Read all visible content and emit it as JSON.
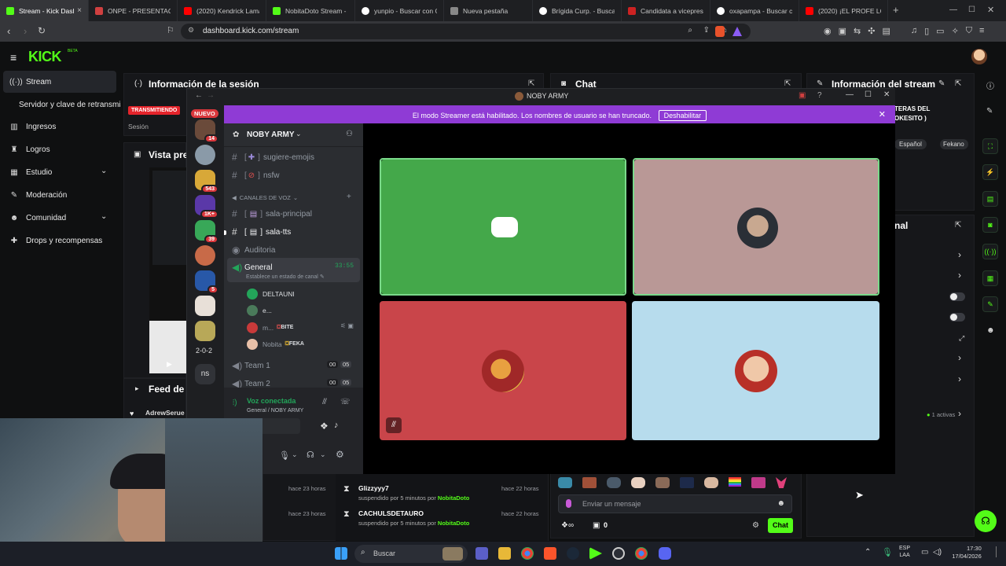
{
  "browser": {
    "tabs": [
      {
        "title": "Stream - Kick Dash",
        "color": "#53fc18",
        "active": true
      },
      {
        "title": "ONPE - PRESENTACIÓN",
        "color": "#d04040"
      },
      {
        "title": "(2020) Kendrick Lamar",
        "color": "#ff0000"
      },
      {
        "title": "NobitaDoto Stream - V",
        "color": "#53fc18"
      },
      {
        "title": "yunpio - Buscar con G",
        "color": "#ffffff"
      },
      {
        "title": "Nueva pestaña",
        "color": "#aaaaaa"
      },
      {
        "title": "Brígida Curp. - Buscar",
        "color": "#ffffff"
      },
      {
        "title": "Candidata a vicepresid",
        "color": "#cc2222"
      },
      {
        "title": "oxapampa - Buscar co",
        "color": "#ffffff"
      },
      {
        "title": "(2020) ¡EL PROFE LO A",
        "color": "#ff0000"
      }
    ],
    "url": "dashboard.kick.com/stream"
  },
  "kick": {
    "logo": "KICK",
    "logo_sup": "BETA",
    "sidebar": [
      {
        "label": "Stream",
        "icon": "stream-icon"
      },
      {
        "label": "Servidor y clave de retransmisión",
        "icon": ""
      },
      {
        "label": "Ingresos",
        "icon": "chart-icon"
      },
      {
        "label": "Logros",
        "icon": "trophy-icon"
      },
      {
        "label": "Estudio",
        "icon": "studio-icon"
      },
      {
        "label": "Moderación",
        "icon": "wrench-icon"
      },
      {
        "label": "Comunidad",
        "icon": "people-icon"
      },
      {
        "label": "Drops y recompensas",
        "icon": "gift-icon"
      }
    ],
    "session_title": "Información de la sesión",
    "session_live": "TRANSMITIENDO",
    "session_label": "Sesión",
    "preview_title": "Vista pre",
    "feed_title": "Feed de a",
    "feed_user": "AdrewSerue",
    "chat_title": "Chat",
    "stream_info_title": "Información del stream",
    "stream_info_text": "TERAS DEL\nOKESITO )",
    "stream_tags": [
      "Español",
      "Fekano"
    ],
    "channel_title": "nal",
    "actives": "1 activas",
    "mod_log": [
      {
        "user": "Glizzyyy7",
        "action": "suspendido por 5 minutos por",
        "mod": "NobitaDoto",
        "time": "hace 22 horas"
      },
      {
        "user": "CACHULSDETAURO",
        "action": "suspendido por 5 minutos por",
        "mod": "NobitaDoto",
        "time": "hace 22 horas"
      }
    ],
    "mod_log_left_times": [
      "hace 23 horas",
      "hace 23 horas"
    ],
    "chat_placeholder": "Enviar un mensaje",
    "chat_points": "0",
    "chat_send": "Chat"
  },
  "discord": {
    "window_title": "NOBY ARMY",
    "banner_text": "El modo Streamer está habilitado. Los nombres de usuario se han truncado.",
    "banner_button": "Deshabilitar",
    "server_name": "NOBY ARMY",
    "new_badge": "NUEVO",
    "server_badges": [
      "14",
      "543",
      "1K+",
      "39",
      "5"
    ],
    "server_text_1": "2-0-2",
    "server_text_2": "ns",
    "channels": {
      "text1": "sugiere-emojis",
      "text2": "nsfw",
      "voice_category": "CANALES DE VOZ",
      "text3": "sala-principal",
      "text4": "sala-tts",
      "auditoria": "Auditoria",
      "general": "General",
      "general_time": "33:55",
      "general_status": "Establece un estado de canal",
      "users": [
        {
          "name": "DELTAUNI",
          "tag": ""
        },
        {
          "name": "e...",
          "tag": ""
        },
        {
          "name": "m...",
          "tag": "BITE"
        },
        {
          "name": "Nobita",
          "tag": "FEKA"
        }
      ],
      "team1": "Team 1",
      "team1_counts": [
        "00",
        "05"
      ],
      "team2": "Team 2",
      "team2_counts": [
        "00",
        "05"
      ]
    },
    "voice_connected": "Voz conectada",
    "voice_location": "General / NOBY ARMY",
    "tile_colors": [
      "#44a84a",
      "#b99896",
      "#c9454a",
      "#b7dced"
    ]
  },
  "taskbar": {
    "search": "Buscar",
    "lang": "ESP",
    "lang2": "LAA",
    "time": "17:30",
    "date": "17/04/2026"
  }
}
